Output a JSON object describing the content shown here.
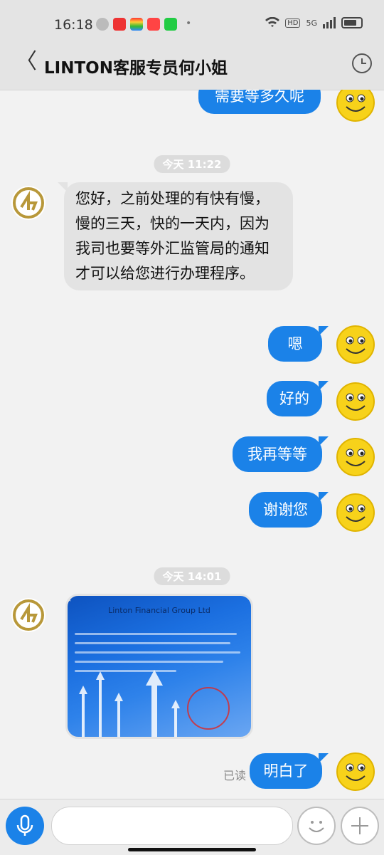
{
  "status_bar": {
    "time": "16:18",
    "network": "5G",
    "hd": "HD"
  },
  "header": {
    "back_icon": "chevron-left-icon",
    "title": "LINTON客服专员何小姐",
    "history_icon": "clock-icon"
  },
  "messages": [
    {
      "type": "outgoing",
      "text": "需要等多久呢"
    },
    {
      "type": "timestamp",
      "text": "今天 11:22"
    },
    {
      "type": "incoming",
      "text": "您好，之前处理的有快有慢，慢的三天，快的一天内，因为我司也要等外汇监管局的通知才可以给您进行办理程序。"
    },
    {
      "type": "outgoing",
      "text": "嗯"
    },
    {
      "type": "outgoing",
      "text": "好的"
    },
    {
      "type": "outgoing",
      "text": "我再等等"
    },
    {
      "type": "outgoing",
      "text": "谢谢您"
    },
    {
      "type": "timestamp",
      "text": "今天 14:01"
    },
    {
      "type": "incoming-image",
      "title": "Linton Financial Group Ltd"
    },
    {
      "type": "outgoing",
      "text": "明白了",
      "read": "已读"
    }
  ],
  "input_bar": {
    "voice_icon": "microphone-icon",
    "emoji_icon": "smiley-icon",
    "plus_icon": "plus-icon",
    "placeholder": ""
  },
  "colors": {
    "accent": "#1b82e8",
    "incoming_bubble": "#e3e3e3",
    "background": "#f2f2f2"
  }
}
